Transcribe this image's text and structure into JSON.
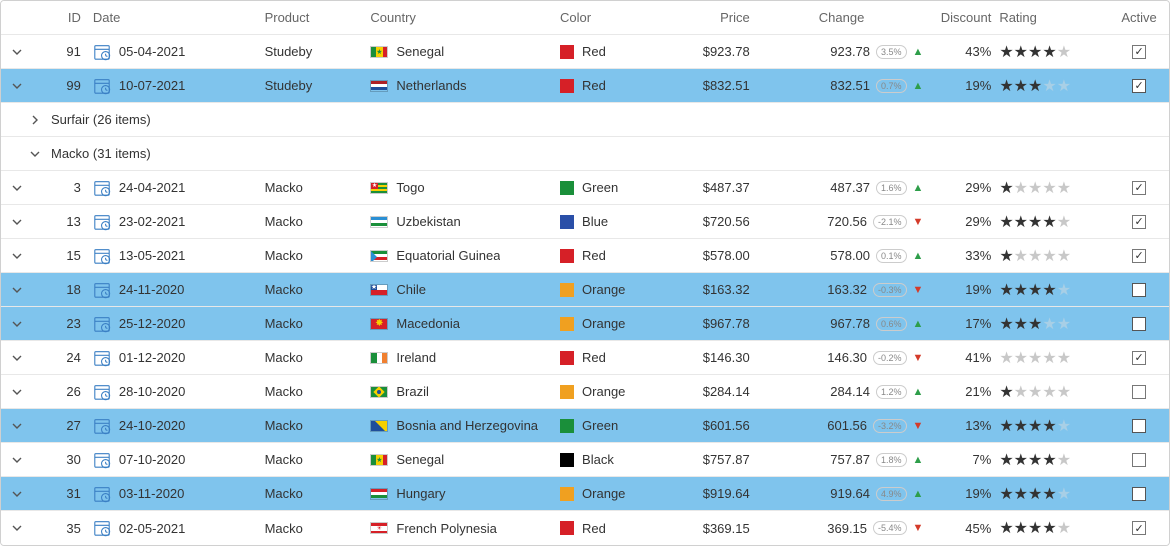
{
  "columns": {
    "id": "ID",
    "date": "Date",
    "product": "Product",
    "country": "Country",
    "color": "Color",
    "price": "Price",
    "change": "Change",
    "discount": "Discount",
    "rating": "Rating",
    "active": "Active"
  },
  "colors": {
    "Red": "#d62027",
    "Green": "#1a8f3a",
    "Blue": "#2a4fa8",
    "Orange": "#f0a020",
    "Black": "#000000"
  },
  "groups": [
    {
      "label": "Surfair (26 items)",
      "expanded": false
    },
    {
      "label": "Macko (31 items)",
      "expanded": true
    }
  ],
  "rows": [
    {
      "seq": 0,
      "id": "91",
      "date": "05-04-2021",
      "product": "Studeby",
      "country": "Senegal",
      "flag": "sn",
      "color": "Red",
      "price": "$923.78",
      "change": "923.78",
      "pct": "3.5%",
      "trend": "up",
      "discount": "43%",
      "rating": 4,
      "active": true,
      "selected": false
    },
    {
      "seq": 1,
      "id": "99",
      "date": "10-07-2021",
      "product": "Studeby",
      "country": "Netherlands",
      "flag": "nl",
      "color": "Red",
      "price": "$832.51",
      "change": "832.51",
      "pct": "0.7%",
      "trend": "up",
      "discount": "19%",
      "rating": 3,
      "active": true,
      "selected": true
    },
    {
      "seq": 2,
      "id": "3",
      "date": "24-04-2021",
      "product": "Macko",
      "country": "Togo",
      "flag": "tg",
      "color": "Green",
      "price": "$487.37",
      "change": "487.37",
      "pct": "1.6%",
      "trend": "up",
      "discount": "29%",
      "rating": 1,
      "active": true,
      "selected": false
    },
    {
      "seq": 3,
      "id": "13",
      "date": "23-02-2021",
      "product": "Macko",
      "country": "Uzbekistan",
      "flag": "uz",
      "color": "Blue",
      "price": "$720.56",
      "change": "720.56",
      "pct": "-2.1%",
      "trend": "down",
      "discount": "29%",
      "rating": 4,
      "active": true,
      "selected": false
    },
    {
      "seq": 4,
      "id": "15",
      "date": "13-05-2021",
      "product": "Macko",
      "country": "Equatorial Guinea",
      "flag": "gq",
      "color": "Red",
      "price": "$578.00",
      "change": "578.00",
      "pct": "0.1%",
      "trend": "up",
      "discount": "33%",
      "rating": 1,
      "active": true,
      "selected": false
    },
    {
      "seq": 5,
      "id": "18",
      "date": "24-11-2020",
      "product": "Macko",
      "country": "Chile",
      "flag": "cl",
      "color": "Orange",
      "price": "$163.32",
      "change": "163.32",
      "pct": "-0.3%",
      "trend": "down",
      "discount": "19%",
      "rating": 4,
      "active": false,
      "selected": true
    },
    {
      "seq": 6,
      "id": "23",
      "date": "25-12-2020",
      "product": "Macko",
      "country": "Macedonia",
      "flag": "mk",
      "color": "Orange",
      "price": "$967.78",
      "change": "967.78",
      "pct": "0.6%",
      "trend": "up",
      "discount": "17%",
      "rating": 3,
      "active": false,
      "selected": true
    },
    {
      "seq": 7,
      "id": "24",
      "date": "01-12-2020",
      "product": "Macko",
      "country": "Ireland",
      "flag": "ie",
      "color": "Red",
      "price": "$146.30",
      "change": "146.30",
      "pct": "-0.2%",
      "trend": "down",
      "discount": "41%",
      "rating": 0,
      "active": true,
      "selected": false
    },
    {
      "seq": 8,
      "id": "26",
      "date": "28-10-2020",
      "product": "Macko",
      "country": "Brazil",
      "flag": "br",
      "color": "Orange",
      "price": "$284.14",
      "change": "284.14",
      "pct": "1.2%",
      "trend": "up",
      "discount": "21%",
      "rating": 1,
      "active": false,
      "selected": false
    },
    {
      "seq": 9,
      "id": "27",
      "date": "24-10-2020",
      "product": "Macko",
      "country": "Bosnia and Herzegovina",
      "flag": "ba",
      "color": "Green",
      "price": "$601.56",
      "change": "601.56",
      "pct": "-3.2%",
      "trend": "down",
      "discount": "13%",
      "rating": 4,
      "active": false,
      "selected": true
    },
    {
      "seq": 10,
      "id": "30",
      "date": "07-10-2020",
      "product": "Macko",
      "country": "Senegal",
      "flag": "sn",
      "color": "Black",
      "price": "$757.87",
      "change": "757.87",
      "pct": "1.8%",
      "trend": "up",
      "discount": "7%",
      "rating": 4,
      "active": false,
      "selected": false
    },
    {
      "seq": 11,
      "id": "31",
      "date": "03-11-2020",
      "product": "Macko",
      "country": "Hungary",
      "flag": "hu",
      "color": "Orange",
      "price": "$919.64",
      "change": "919.64",
      "pct": "4.9%",
      "trend": "up",
      "discount": "19%",
      "rating": 4,
      "active": false,
      "selected": true
    },
    {
      "seq": 12,
      "id": "35",
      "date": "02-05-2021",
      "product": "Macko",
      "country": "French Polynesia",
      "flag": "pf",
      "color": "Red",
      "price": "$369.15",
      "change": "369.15",
      "pct": "-5.4%",
      "trend": "down",
      "discount": "45%",
      "rating": 4,
      "active": true,
      "selected": false
    }
  ]
}
